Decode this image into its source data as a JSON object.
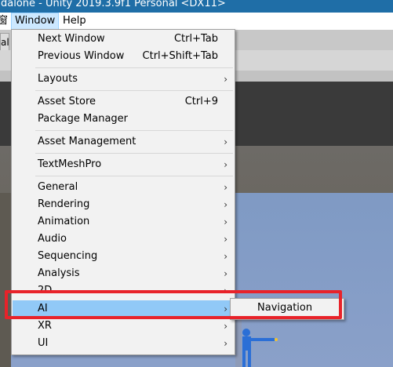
{
  "window": {
    "title": "dalone - Unity 2019.3.9f1 Personal <DX11>"
  },
  "menubar": {
    "partial_item": "窗",
    "window": "Window",
    "help": "Help"
  },
  "toolbar": {
    "tab_fragment": "al"
  },
  "menu": {
    "next_window": {
      "label": "Next Window",
      "shortcut": "Ctrl+Tab"
    },
    "previous_window": {
      "label": "Previous Window",
      "shortcut": "Ctrl+Shift+Tab"
    },
    "layouts": {
      "label": "Layouts",
      "arrow": "›"
    },
    "asset_store": {
      "label": "Asset Store",
      "shortcut": "Ctrl+9"
    },
    "package_manager": {
      "label": "Package Manager"
    },
    "asset_management": {
      "label": "Asset Management",
      "arrow": "›"
    },
    "textmeshpro": {
      "label": "TextMeshPro",
      "arrow": "›"
    },
    "general": {
      "label": "General",
      "arrow": "›"
    },
    "rendering": {
      "label": "Rendering",
      "arrow": "›"
    },
    "animation": {
      "label": "Animation",
      "arrow": "›"
    },
    "audio": {
      "label": "Audio",
      "arrow": "›"
    },
    "sequencing": {
      "label": "Sequencing",
      "arrow": "›"
    },
    "analysis": {
      "label": "Analysis",
      "arrow": "›"
    },
    "two_d": {
      "label": "2D",
      "arrow": "›"
    },
    "ai": {
      "label": "AI",
      "arrow": "›"
    },
    "xr": {
      "label": "XR",
      "arrow": "›"
    },
    "ui": {
      "label": "UI",
      "arrow": "›"
    }
  },
  "submenu": {
    "navigation": "Navigation"
  },
  "colors": {
    "highlight": "#91c9f7",
    "annotation_box": "#e8232a",
    "titlebar": "#1f6ea7"
  }
}
